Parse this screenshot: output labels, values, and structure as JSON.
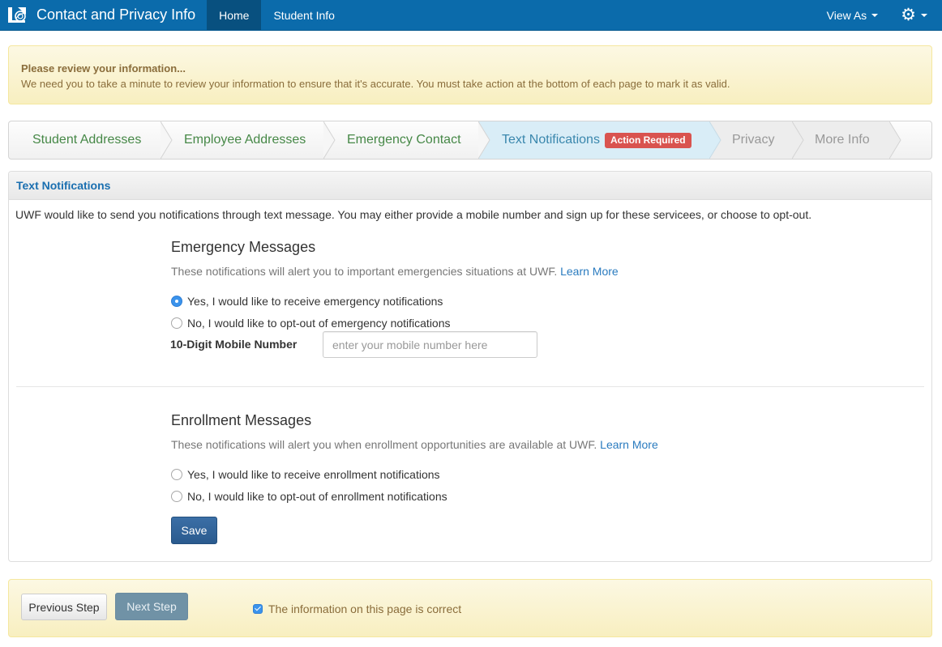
{
  "navbar": {
    "app_title": "Contact and Privacy Info",
    "logo_icon": "uwf-nautilus-logo",
    "items": [
      {
        "label": "Home",
        "active": true
      },
      {
        "label": "Student Info",
        "active": false
      }
    ],
    "view_as_label": "View As",
    "settings_icon": "gear-icon"
  },
  "review_alert": {
    "title": "Please review your information...",
    "message": "We need you to take a minute to review your information to ensure that it's accurate. You must take action at the bottom of each page to mark it as valid."
  },
  "steps": [
    {
      "label": "Student Addresses",
      "state": "done"
    },
    {
      "label": "Employee Addresses",
      "state": "done"
    },
    {
      "label": "Emergency Contact",
      "state": "done"
    },
    {
      "label": "Text Notifications",
      "state": "current",
      "badge": "Action Required"
    },
    {
      "label": "Privacy",
      "state": "future"
    },
    {
      "label": "More Info",
      "state": "future"
    }
  ],
  "panel": {
    "heading": "Text Notifications",
    "intro": "UWF would like to send you notifications through text message. You may either provide a mobile number and sign up for these servicees, or choose to opt-out.",
    "emergency": {
      "title": "Emergency Messages",
      "description": "These notifications will alert you to important emergencies situations at UWF.",
      "learn_more": "Learn More",
      "options": [
        {
          "label": "Yes, I would like to receive emergency notifications",
          "checked": true
        },
        {
          "label": "No, I would like to opt-out of emergency notifications",
          "checked": false
        }
      ],
      "mobile_label": "10-Digit Mobile Number",
      "mobile_value": "",
      "mobile_placeholder": "enter your mobile number here"
    },
    "enrollment": {
      "title": "Enrollment Messages",
      "description": "These notifications will alert you when enrollment opportunities are available at UWF.",
      "learn_more": "Learn More",
      "options": [
        {
          "label": "Yes, I would like to receive enrollment notifications",
          "checked": false
        },
        {
          "label": "No, I would like to opt-out of enrollment notifications",
          "checked": false
        }
      ]
    },
    "save_label": "Save"
  },
  "footer": {
    "previous_label": "Previous Step",
    "next_label": "Next Step",
    "confirm_label": "The information on this page is correct",
    "confirm_checked": true
  },
  "colors": {
    "navbar": "#0b6bab",
    "step_done": "#468847",
    "step_current": "#3a87ad",
    "step_current_bg": "#d9edf7",
    "badge_danger": "#d9534f",
    "alert_text": "#8a6d3b",
    "link": "#2a7bbf",
    "save_button": "#2f6095"
  }
}
